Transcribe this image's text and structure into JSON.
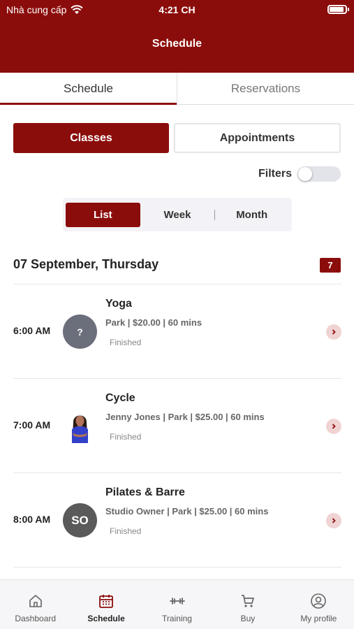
{
  "status_bar": {
    "carrier": "Nhà cung cấp",
    "time": "4:21 CH",
    "battery_level": 0.9
  },
  "header": {
    "title": "Schedule"
  },
  "top_tabs": [
    {
      "label": "Schedule",
      "active": true
    },
    {
      "label": "Reservations",
      "active": false
    }
  ],
  "segments": {
    "classes": "Classes",
    "appointments": "Appointments",
    "selected": "Classes"
  },
  "filters": {
    "label": "Filters",
    "enabled": false
  },
  "view_modes": {
    "list": "List",
    "week": "Week",
    "month": "Month",
    "selected": "List"
  },
  "schedule": {
    "date": "07 September, Thursday",
    "count": "7",
    "items": [
      {
        "time": "6:00 AM",
        "name": "Yoga",
        "meta": "Park | $20.00 | 60 mins",
        "status": "Finished",
        "avatar": "?"
      },
      {
        "time": "7:00 AM",
        "name": "Cycle",
        "meta": "Jenny Jones | Park | $25.00 | 60 mins",
        "status": "Finished",
        "avatar": ""
      },
      {
        "time": "8:00 AM",
        "name": "Pilates & Barre",
        "meta": "Studio Owner | Park | $25.00 | 60 mins",
        "status": "Finished",
        "avatar": "SO"
      }
    ]
  },
  "bottom_nav": [
    {
      "label": "Dashboard",
      "icon": "home-icon"
    },
    {
      "label": "Schedule",
      "icon": "calendar-icon",
      "active": true
    },
    {
      "label": "Training",
      "icon": "dumbbell-icon"
    },
    {
      "label": "Buy",
      "icon": "cart-icon"
    },
    {
      "label": "My profile",
      "icon": "user-icon"
    }
  ],
  "colors": {
    "brand": "#8b0d0b",
    "chevron_bg": "#f0d3d3"
  }
}
